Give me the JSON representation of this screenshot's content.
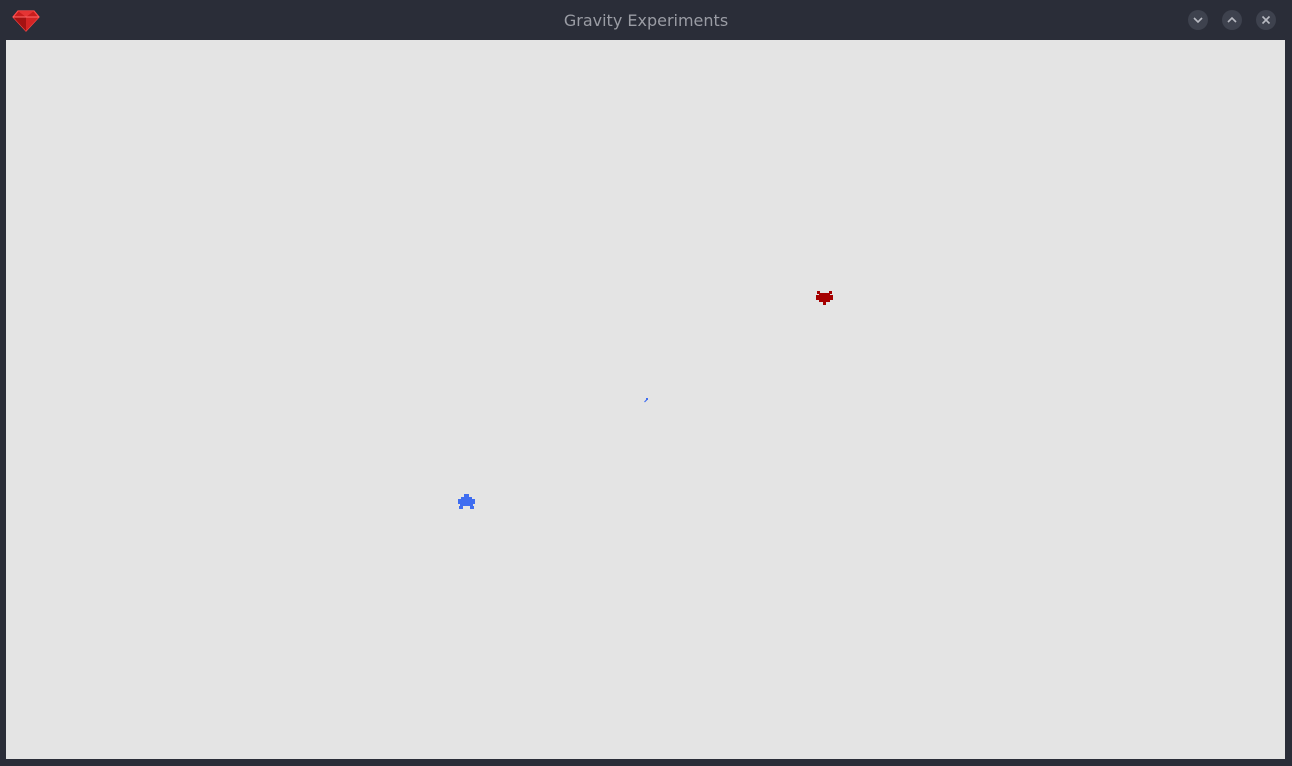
{
  "window": {
    "title": "Gravity Experiments",
    "app_icon": "ruby-gem-icon",
    "controls": [
      "minimize-icon",
      "maximize-icon",
      "close-icon"
    ]
  },
  "scene": {
    "background_color": "#e4e4e4",
    "bodies": [
      {
        "name": "red-body",
        "color": "#a50000"
      },
      {
        "name": "blue-body",
        "color": "#3f6df0"
      }
    ],
    "probe_color": "#3f6df0"
  }
}
